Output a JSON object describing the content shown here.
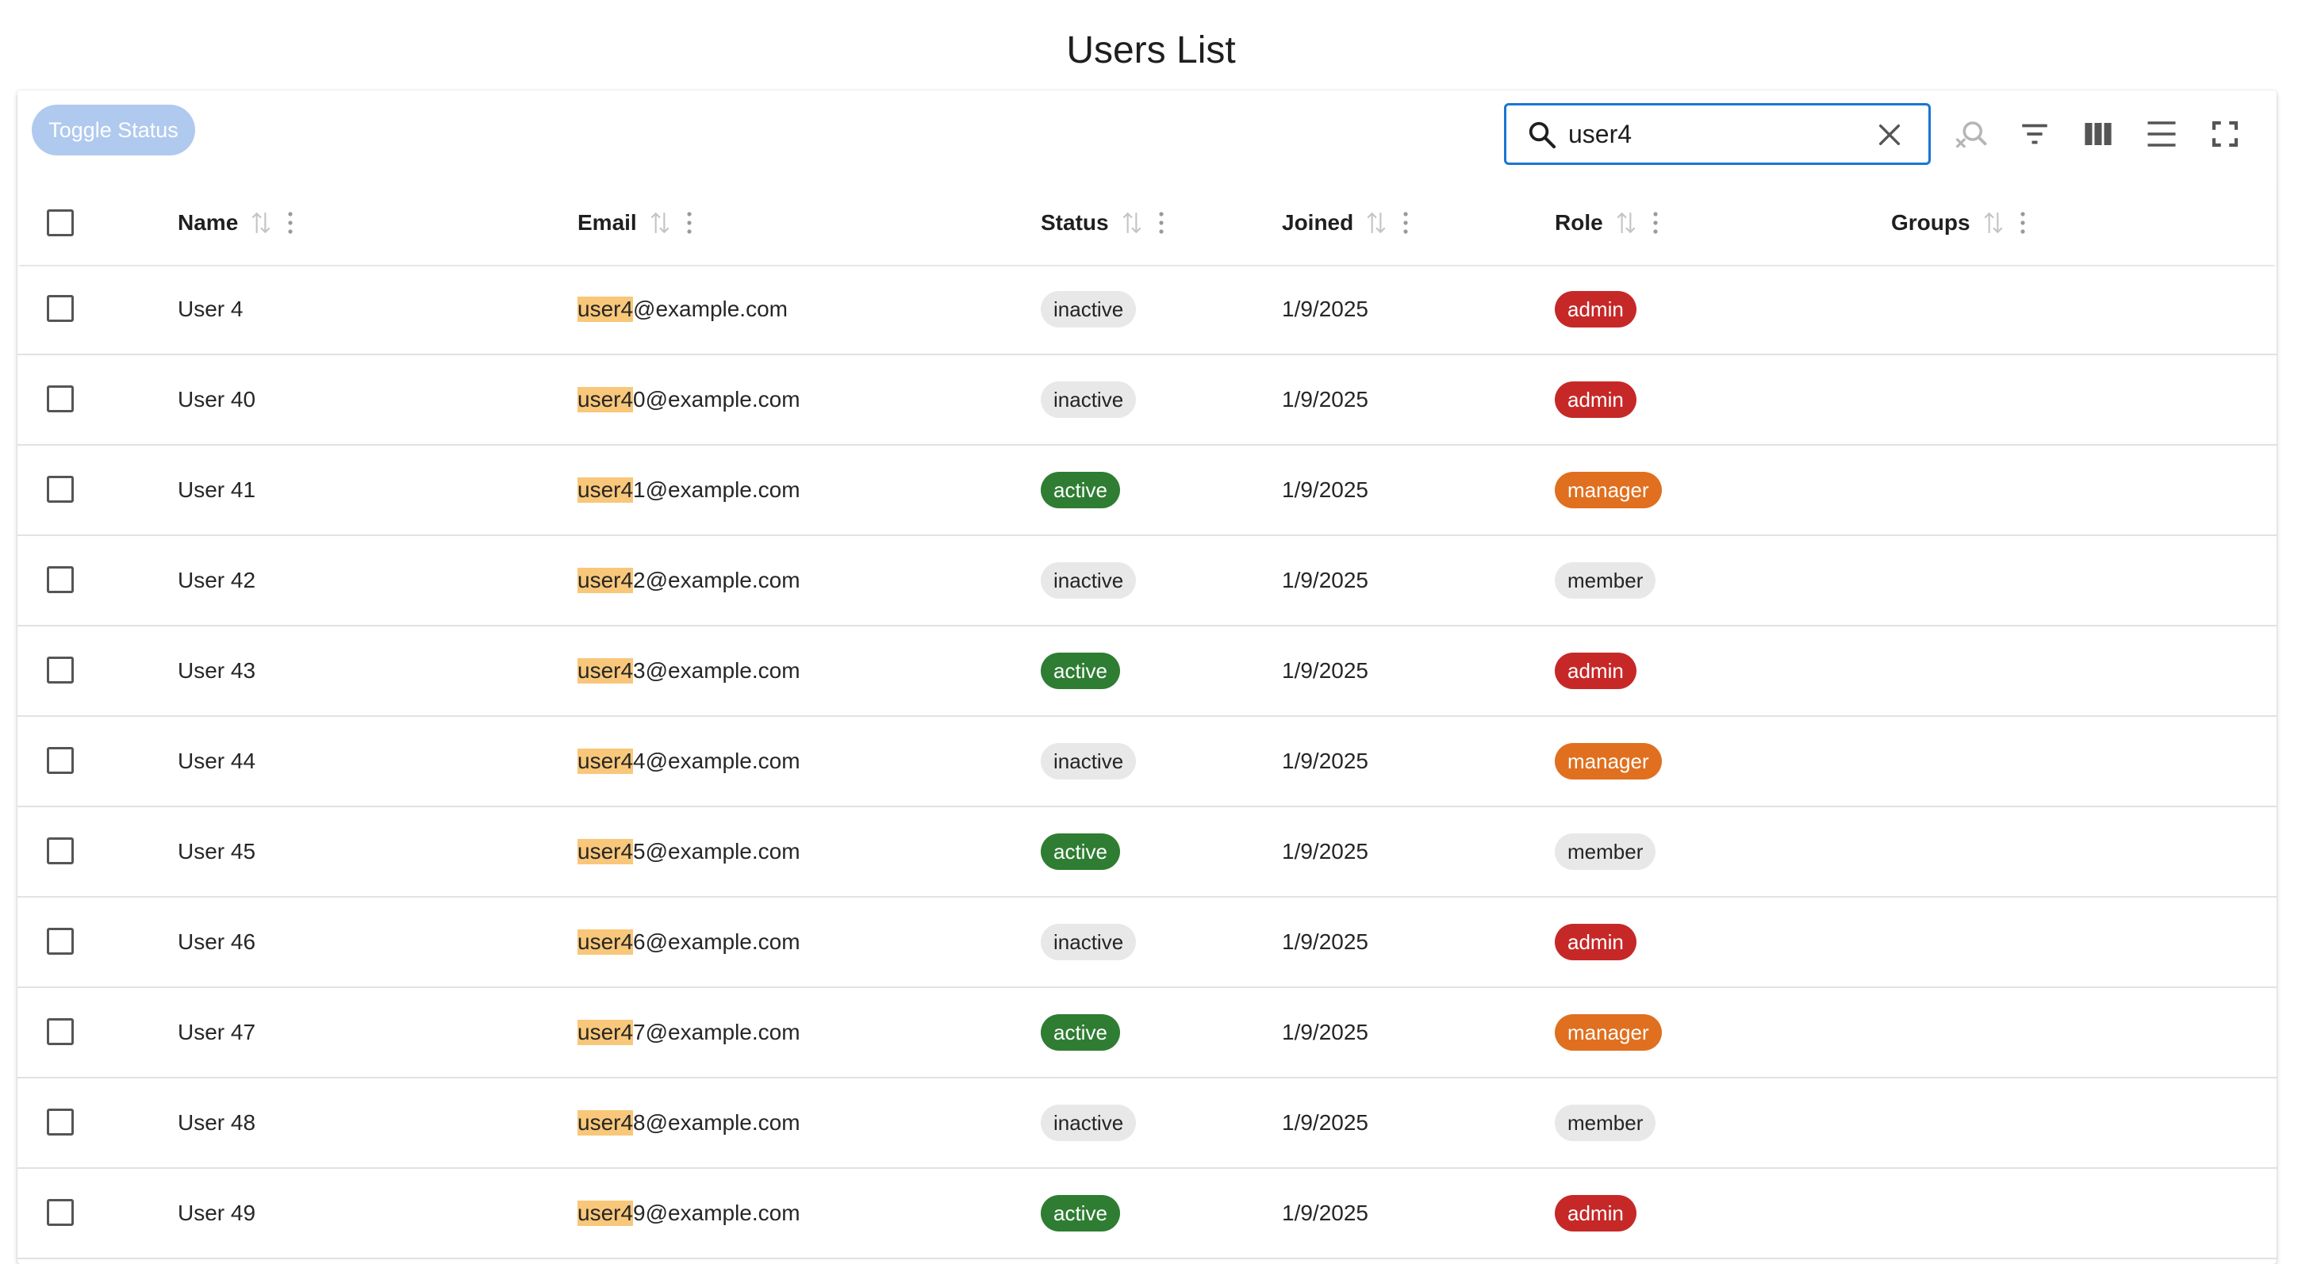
{
  "page": {
    "title": "Users List"
  },
  "toolbar": {
    "toggle_status_label": "Toggle Status",
    "search_value": "user4",
    "icons": [
      "search-icon",
      "clear-icon",
      "search-off-icon",
      "filter-icon",
      "columns-icon",
      "density-icon",
      "fullscreen-icon"
    ]
  },
  "table": {
    "columns": [
      "Name",
      "Email",
      "Status",
      "Joined",
      "Role",
      "Groups"
    ],
    "highlight": "user4",
    "rows": [
      {
        "name": "User 4",
        "email": "user4@example.com",
        "email_rest": "@example.com",
        "status": "inactive",
        "joined": "1/9/2025",
        "role": "admin",
        "groups": ""
      },
      {
        "name": "User 40",
        "email": "user40@example.com",
        "email_rest": "0@example.com",
        "status": "inactive",
        "joined": "1/9/2025",
        "role": "admin",
        "groups": ""
      },
      {
        "name": "User 41",
        "email": "user41@example.com",
        "email_rest": "1@example.com",
        "status": "active",
        "joined": "1/9/2025",
        "role": "manager",
        "groups": ""
      },
      {
        "name": "User 42",
        "email": "user42@example.com",
        "email_rest": "2@example.com",
        "status": "inactive",
        "joined": "1/9/2025",
        "role": "member",
        "groups": ""
      },
      {
        "name": "User 43",
        "email": "user43@example.com",
        "email_rest": "3@example.com",
        "status": "active",
        "joined": "1/9/2025",
        "role": "admin",
        "groups": ""
      },
      {
        "name": "User 44",
        "email": "user44@example.com",
        "email_rest": "4@example.com",
        "status": "inactive",
        "joined": "1/9/2025",
        "role": "manager",
        "groups": ""
      },
      {
        "name": "User 45",
        "email": "user45@example.com",
        "email_rest": "5@example.com",
        "status": "active",
        "joined": "1/9/2025",
        "role": "member",
        "groups": ""
      },
      {
        "name": "User 46",
        "email": "user46@example.com",
        "email_rest": "6@example.com",
        "status": "inactive",
        "joined": "1/9/2025",
        "role": "admin",
        "groups": ""
      },
      {
        "name": "User 47",
        "email": "user47@example.com",
        "email_rest": "7@example.com",
        "status": "active",
        "joined": "1/9/2025",
        "role": "manager",
        "groups": ""
      },
      {
        "name": "User 48",
        "email": "user48@example.com",
        "email_rest": "8@example.com",
        "status": "inactive",
        "joined": "1/9/2025",
        "role": "member",
        "groups": ""
      },
      {
        "name": "User 49",
        "email": "user49@example.com",
        "email_rest": "9@example.com",
        "status": "active",
        "joined": "1/9/2025",
        "role": "admin",
        "groups": ""
      }
    ]
  },
  "colors": {
    "accent": "#1976d2",
    "toggle_button_disabled": "#b0c9ee",
    "highlight": "#f8c77a",
    "status_active": "#2e7d32",
    "status_inactive": "#e8e8e8",
    "role_admin": "#c62828",
    "role_manager": "#e06f1f",
    "role_member": "#e8e8e8"
  }
}
